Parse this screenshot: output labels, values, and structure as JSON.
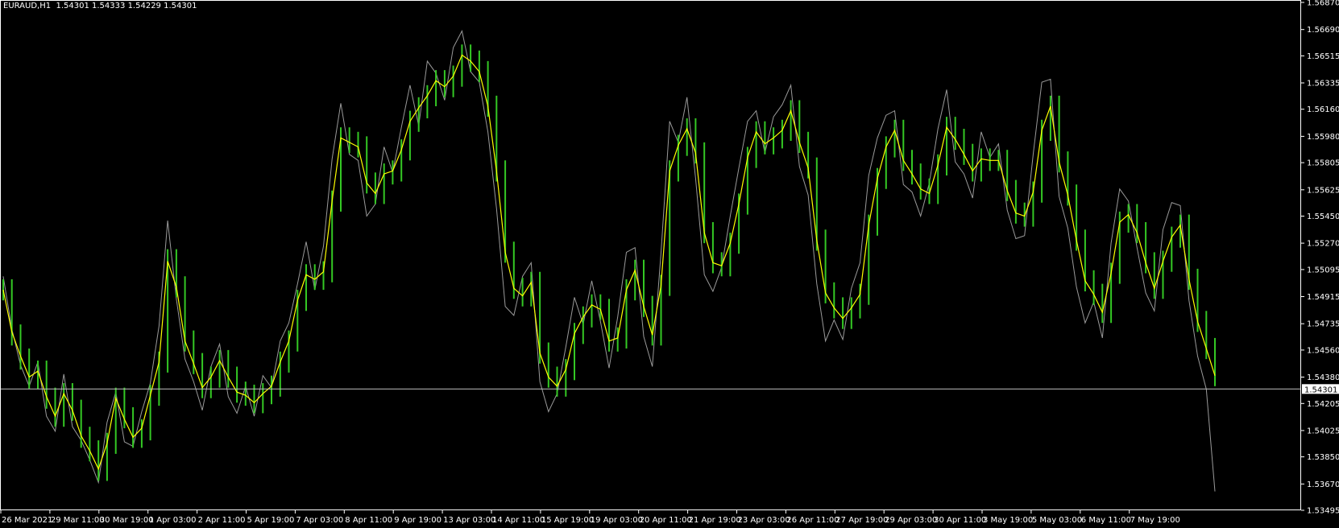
{
  "symbol": "EURAUD,H1",
  "ohlc": {
    "open": "1.54301",
    "high": "1.54333",
    "low": "1.54229",
    "close": "1.54301"
  },
  "colors": {
    "background": "#000000",
    "candles": "#34c824",
    "ma": "#ffff00",
    "overlay": "#9a9a9a",
    "axis": "#ffffff",
    "price_line": "#c0c0c0"
  },
  "chart_data": {
    "type": "line",
    "symbol": "EURAUD",
    "timeframe": "H1",
    "current_price": "1.54301",
    "ylim": [
      1.53495,
      1.5687
    ],
    "y_ticks": [
      "1.56870",
      "1.56690",
      "1.56515",
      "1.56335",
      "1.56160",
      "1.55980",
      "1.55805",
      "1.55625",
      "1.55450",
      "1.55270",
      "1.55095",
      "1.54915",
      "1.54735",
      "1.54560",
      "1.54380",
      "1.54205",
      "1.54025",
      "1.53850",
      "1.53670",
      "1.53495"
    ],
    "x_ticks": [
      "26 Mar 2021",
      "29 Mar 11:00",
      "30 Mar 19:00",
      "1 Apr 03:00",
      "2 Apr 11:00",
      "5 Apr 19:00",
      "7 Apr 03:00",
      "8 Apr 11:00",
      "9 Apr 19:00",
      "13 Apr 03:00",
      "14 Apr 11:00",
      "15 Apr 19:00",
      "19 Apr 03:00",
      "20 Apr 11:00",
      "21 Apr 19:00",
      "23 Apr 03:00",
      "26 Apr 11:00",
      "27 Apr 19:00",
      "29 Apr 03:00",
      "30 Apr 11:00",
      "3 May 19:00",
      "5 May 03:00",
      "6 May 11:00",
      "7 May 19:00"
    ],
    "series": [
      {
        "style": "candles",
        "values": [
          1.5496,
          1.5466,
          1.545,
          1.5437,
          1.5442,
          1.5424,
          1.5412,
          1.5427,
          1.5416,
          1.5398,
          1.5389,
          1.5376,
          1.5394,
          1.5424,
          1.5411,
          1.5398,
          1.5403,
          1.5426,
          1.5448,
          1.5516,
          1.5498,
          1.5462,
          1.5447,
          1.5431,
          1.5438,
          1.5449,
          1.5438,
          1.5428,
          1.5426,
          1.5421,
          1.5427,
          1.5432,
          1.5448,
          1.5462,
          1.5489,
          1.5506,
          1.5503,
          1.5508,
          1.5555,
          1.5597,
          1.5594,
          1.5591,
          1.5567,
          1.556,
          1.5573,
          1.5575,
          1.5589,
          1.5608,
          1.5617,
          1.5625,
          1.5635,
          1.5631,
          1.5638,
          1.5652,
          1.5648,
          1.5641,
          1.5618,
          1.5575,
          1.5521,
          1.5497,
          1.5492,
          1.5501,
          1.5454,
          1.5438,
          1.5432,
          1.5443,
          1.5467,
          1.5478,
          1.5486,
          1.5483,
          1.5462,
          1.5464,
          1.5496,
          1.5509,
          1.5485,
          1.5466,
          1.5499,
          1.5575,
          1.5592,
          1.5603,
          1.5587,
          1.5534,
          1.5514,
          1.5512,
          1.5527,
          1.5553,
          1.5584,
          1.5601,
          1.5593,
          1.5597,
          1.5602,
          1.5615,
          1.5594,
          1.5577,
          1.5529,
          1.5494,
          1.5484,
          1.5477,
          1.5484,
          1.5493,
          1.5539,
          1.557,
          1.5591,
          1.5602,
          1.5582,
          1.5573,
          1.5563,
          1.556,
          1.5579,
          1.5604,
          1.5596,
          1.5586,
          1.5575,
          1.5583,
          1.5582,
          1.5582,
          1.5562,
          1.5547,
          1.5545,
          1.5561,
          1.5602,
          1.5618,
          1.5581,
          1.5559,
          1.5529,
          1.5502,
          1.5493,
          1.5481,
          1.5507,
          1.5541,
          1.5546,
          1.5534,
          1.5514,
          1.5497,
          1.5515,
          1.5531,
          1.5539,
          1.5503,
          1.5475,
          1.5457,
          1.5439
        ]
      },
      {
        "style": "line",
        "name": "",
        "values": [
          1.5496,
          1.5468,
          1.5452,
          1.5438,
          1.5442,
          1.5425,
          1.5412,
          1.5427,
          1.5416,
          1.5399,
          1.5389,
          1.5377,
          1.5394,
          1.5424,
          1.541,
          1.5398,
          1.5404,
          1.5426,
          1.5448,
          1.5515,
          1.5498,
          1.5462,
          1.5447,
          1.5431,
          1.5438,
          1.5449,
          1.5438,
          1.5428,
          1.5426,
          1.5421,
          1.5427,
          1.5432,
          1.5448,
          1.5462,
          1.5489,
          1.5506,
          1.5503,
          1.5508,
          1.5555,
          1.5597,
          1.5594,
          1.5591,
          1.5567,
          1.556,
          1.5573,
          1.5575,
          1.5589,
          1.5608,
          1.5617,
          1.5625,
          1.5635,
          1.5631,
          1.5638,
          1.5652,
          1.5648,
          1.5641,
          1.5618,
          1.5575,
          1.5521,
          1.5497,
          1.5492,
          1.5501,
          1.5454,
          1.5438,
          1.5432,
          1.5443,
          1.5467,
          1.5478,
          1.5486,
          1.5483,
          1.5462,
          1.5464,
          1.5496,
          1.5509,
          1.5485,
          1.5466,
          1.5499,
          1.5575,
          1.5592,
          1.5603,
          1.5587,
          1.5534,
          1.5514,
          1.5512,
          1.5527,
          1.5553,
          1.5584,
          1.5601,
          1.5593,
          1.5597,
          1.5602,
          1.5615,
          1.5594,
          1.5577,
          1.5529,
          1.5494,
          1.5484,
          1.5477,
          1.5484,
          1.5493,
          1.5539,
          1.557,
          1.5591,
          1.5602,
          1.5582,
          1.5573,
          1.5563,
          1.556,
          1.5579,
          1.5604,
          1.5596,
          1.5586,
          1.5575,
          1.5583,
          1.5582,
          1.5582,
          1.5562,
          1.5547,
          1.5545,
          1.5561,
          1.5602,
          1.5618,
          1.5581,
          1.5559,
          1.5529,
          1.5502,
          1.5493,
          1.5481,
          1.5507,
          1.5541,
          1.5546,
          1.5534,
          1.5514,
          1.5497,
          1.5515,
          1.5531,
          1.5539,
          1.5503,
          1.5475,
          1.5457,
          1.5439
        ]
      },
      {
        "style": "line",
        "name": "",
        "values": [
          1.5505,
          1.547,
          1.5446,
          1.5432,
          1.5448,
          1.5412,
          1.5402,
          1.544,
          1.5405,
          1.5396,
          1.5383,
          1.5368,
          1.5408,
          1.5428,
          1.5395,
          1.5392,
          1.5415,
          1.5434,
          1.5472,
          1.5542,
          1.549,
          1.545,
          1.5435,
          1.5416,
          1.5445,
          1.546,
          1.5425,
          1.5414,
          1.5432,
          1.5412,
          1.5439,
          1.5431,
          1.5462,
          1.5474,
          1.55,
          1.5528,
          1.5496,
          1.5525,
          1.5583,
          1.562,
          1.5586,
          1.5582,
          1.5545,
          1.5553,
          1.5591,
          1.5574,
          1.5604,
          1.5632,
          1.5605,
          1.5648,
          1.564,
          1.5622,
          1.5657,
          1.5668,
          1.5641,
          1.5634,
          1.5601,
          1.555,
          1.5485,
          1.5479,
          1.5505,
          1.5514,
          1.5435,
          1.5415,
          1.5427,
          1.5458,
          1.5491,
          1.5473,
          1.5502,
          1.5475,
          1.5444,
          1.5478,
          1.5521,
          1.5524,
          1.5465,
          1.5445,
          1.5521,
          1.5608,
          1.5594,
          1.5624,
          1.557,
          1.5506,
          1.5495,
          1.5511,
          1.5545,
          1.5577,
          1.5608,
          1.5615,
          1.5587,
          1.5611,
          1.5619,
          1.5632,
          1.5578,
          1.5559,
          1.55,
          1.5462,
          1.5476,
          1.5463,
          1.5497,
          1.5514,
          1.5572,
          1.5597,
          1.5612,
          1.5615,
          1.5566,
          1.5561,
          1.5545,
          1.5567,
          1.5603,
          1.5629,
          1.5581,
          1.5573,
          1.5557,
          1.5601,
          1.5584,
          1.5593,
          1.5549,
          1.553,
          1.5532,
          1.5586,
          1.5634,
          1.5636,
          1.5558,
          1.5537,
          1.5498,
          1.5474,
          1.5488,
          1.5464,
          1.5527,
          1.5563,
          1.5555,
          1.5524,
          1.5494,
          1.5482,
          1.5536,
          1.5554,
          1.5552,
          1.5489,
          1.5452,
          1.543,
          1.5362
        ]
      }
    ]
  }
}
